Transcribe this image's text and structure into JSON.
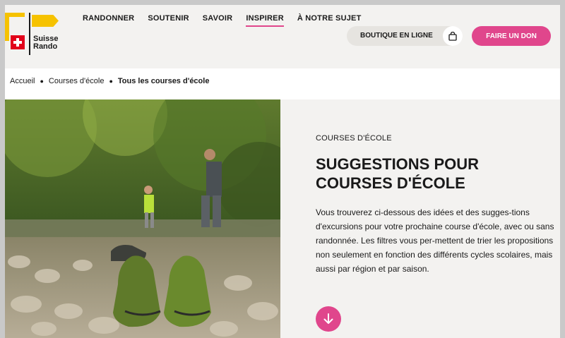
{
  "logo": {
    "line1": "Suisse",
    "line2": "Rando"
  },
  "nav": [
    {
      "label": "RANDONNER"
    },
    {
      "label": "SOUTENIR"
    },
    {
      "label": "SAVOIR"
    },
    {
      "label": "INSPIRER"
    },
    {
      "label": "À NOTRE SUJET"
    }
  ],
  "header": {
    "shop_label": "BOUTIQUE EN LIGNE",
    "donate_label": "FAIRE UN DON"
  },
  "breadcrumb": [
    "Accueil",
    "Courses d'école",
    "Tous les courses d'école"
  ],
  "hero": {
    "eyebrow": "COURSES D'ÉCOLE",
    "title": "SUGGESTIONS POUR COURSES D'ÉCOLE",
    "text": "Vous trouverez ci-dessous des idées et des sugges-tions d'excursions pour votre prochaine course d'école, avec ou sans randonnée. Les filtres vous per-mettent de trier les propositions non seulement en fonction des différents cycles scolaires, mais aussi par région et par saison."
  },
  "colors": {
    "accent": "#e0468c",
    "brand_yellow": "#f6c200",
    "swiss_red": "#e2001a"
  }
}
